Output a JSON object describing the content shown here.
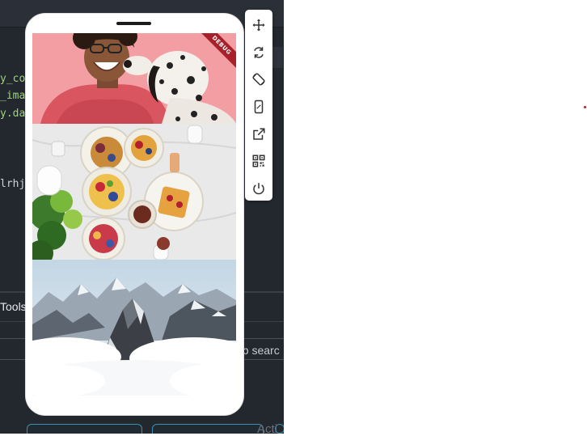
{
  "ide": {
    "code_lines": [
      "y_co",
      "_ima",
      "y.da",
      "lrhj"
    ],
    "tools_label": "Tools",
    "search_hint": "ub searc",
    "activity_label": "Acti"
  },
  "phone": {
    "debug_banner": "DEBUG",
    "photos": [
      {
        "name": "woman-with-dalmatian"
      },
      {
        "name": "breakfast-table"
      },
      {
        "name": "snowy-mountain-peaks"
      }
    ]
  },
  "toolbar": {
    "tools": [
      {
        "icon": "move-icon"
      },
      {
        "icon": "refresh-icon"
      },
      {
        "icon": "rotate-device-icon"
      },
      {
        "icon": "phone-frame-icon"
      },
      {
        "icon": "open-external-icon"
      },
      {
        "icon": "qr-code-icon"
      },
      {
        "icon": "power-icon"
      }
    ]
  },
  "colors": {
    "ide_bg": "#23272e",
    "code_green": "#9cd67a",
    "debug_red": "#a8202a",
    "accent_blue": "#3f8fb0"
  }
}
